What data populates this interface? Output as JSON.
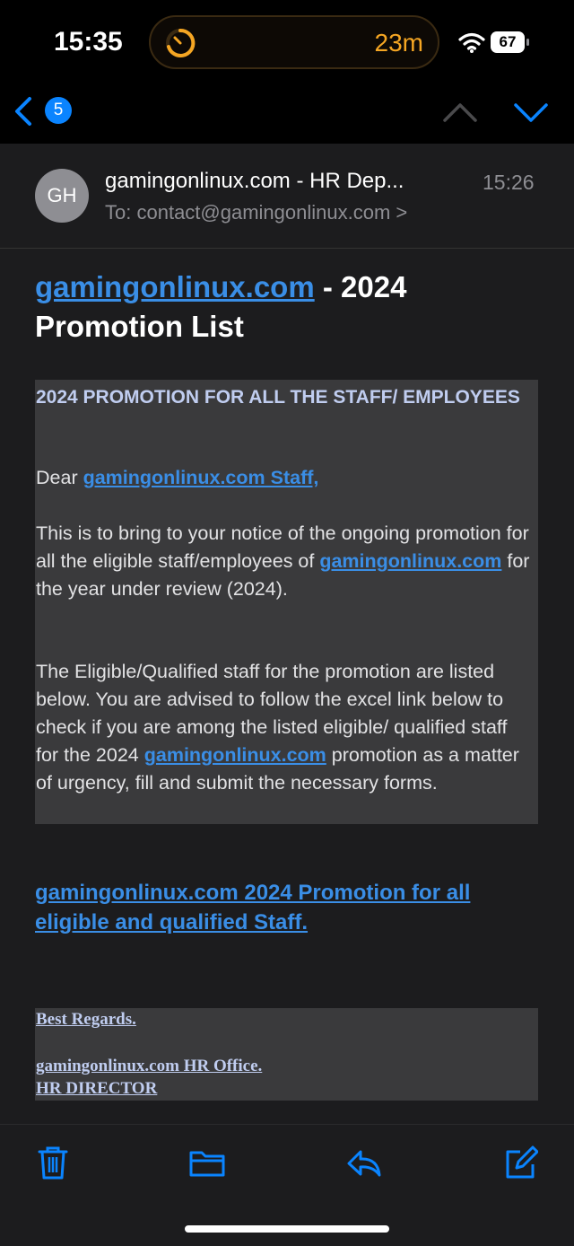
{
  "status_bar": {
    "time": "15:35",
    "timer": "23m",
    "battery": "67"
  },
  "nav": {
    "unread_count": "5",
    "icons": [
      "chevron-left-icon",
      "chevron-up-icon",
      "chevron-down-icon"
    ]
  },
  "header": {
    "avatar_initials": "GH",
    "sender": "gamingonlinux.com - HR Dep...",
    "date": "15:26",
    "to_label": "To:",
    "to_address": "contact@gamingonlinux.com",
    "to_chevron": ">"
  },
  "email": {
    "subject_link": "gamingonlinux.com",
    "subject_rest": " - 2024 Promotion List",
    "box_heading": "2024 PROMOTION FOR ALL THE STAFF/ EMPLOYEES",
    "greeting_prefix": "Dear ",
    "greeting_link": "gamingonlinux.com Staff,",
    "para1_a": "This is to bring to your notice of the ongoing promotion for all the eligible staff/employees of ",
    "para1_link": "gamingonlinux.com",
    "para1_b": " for the year under review (2024).",
    "para2_a": "The Eligible/Qualified staff for the promotion are listed below. You are advised to follow the excel link below to check if you are among the listed eligible/ qualified staff for the 2024 ",
    "para2_link": "gamingonlinux.com",
    "para2_b": " promotion as a matter of urgency, fill and submit the necessary forms.",
    "promo_link": "gamingonlinux.com 2024 Promotion for all eligible and qualified Staff.",
    "sign_regards": "Best Regards.",
    "sign_office": "gamingonlinux.com HR Office.",
    "sign_title": "HR DIRECTOR"
  },
  "toolbar": {
    "icons": [
      "trash-icon",
      "folder-icon",
      "reply-icon",
      "compose-icon"
    ]
  },
  "colors": {
    "accent": "#0a84ff",
    "link": "#3a8ee6",
    "timer": "#f5a623",
    "background": "#1c1c1e"
  }
}
